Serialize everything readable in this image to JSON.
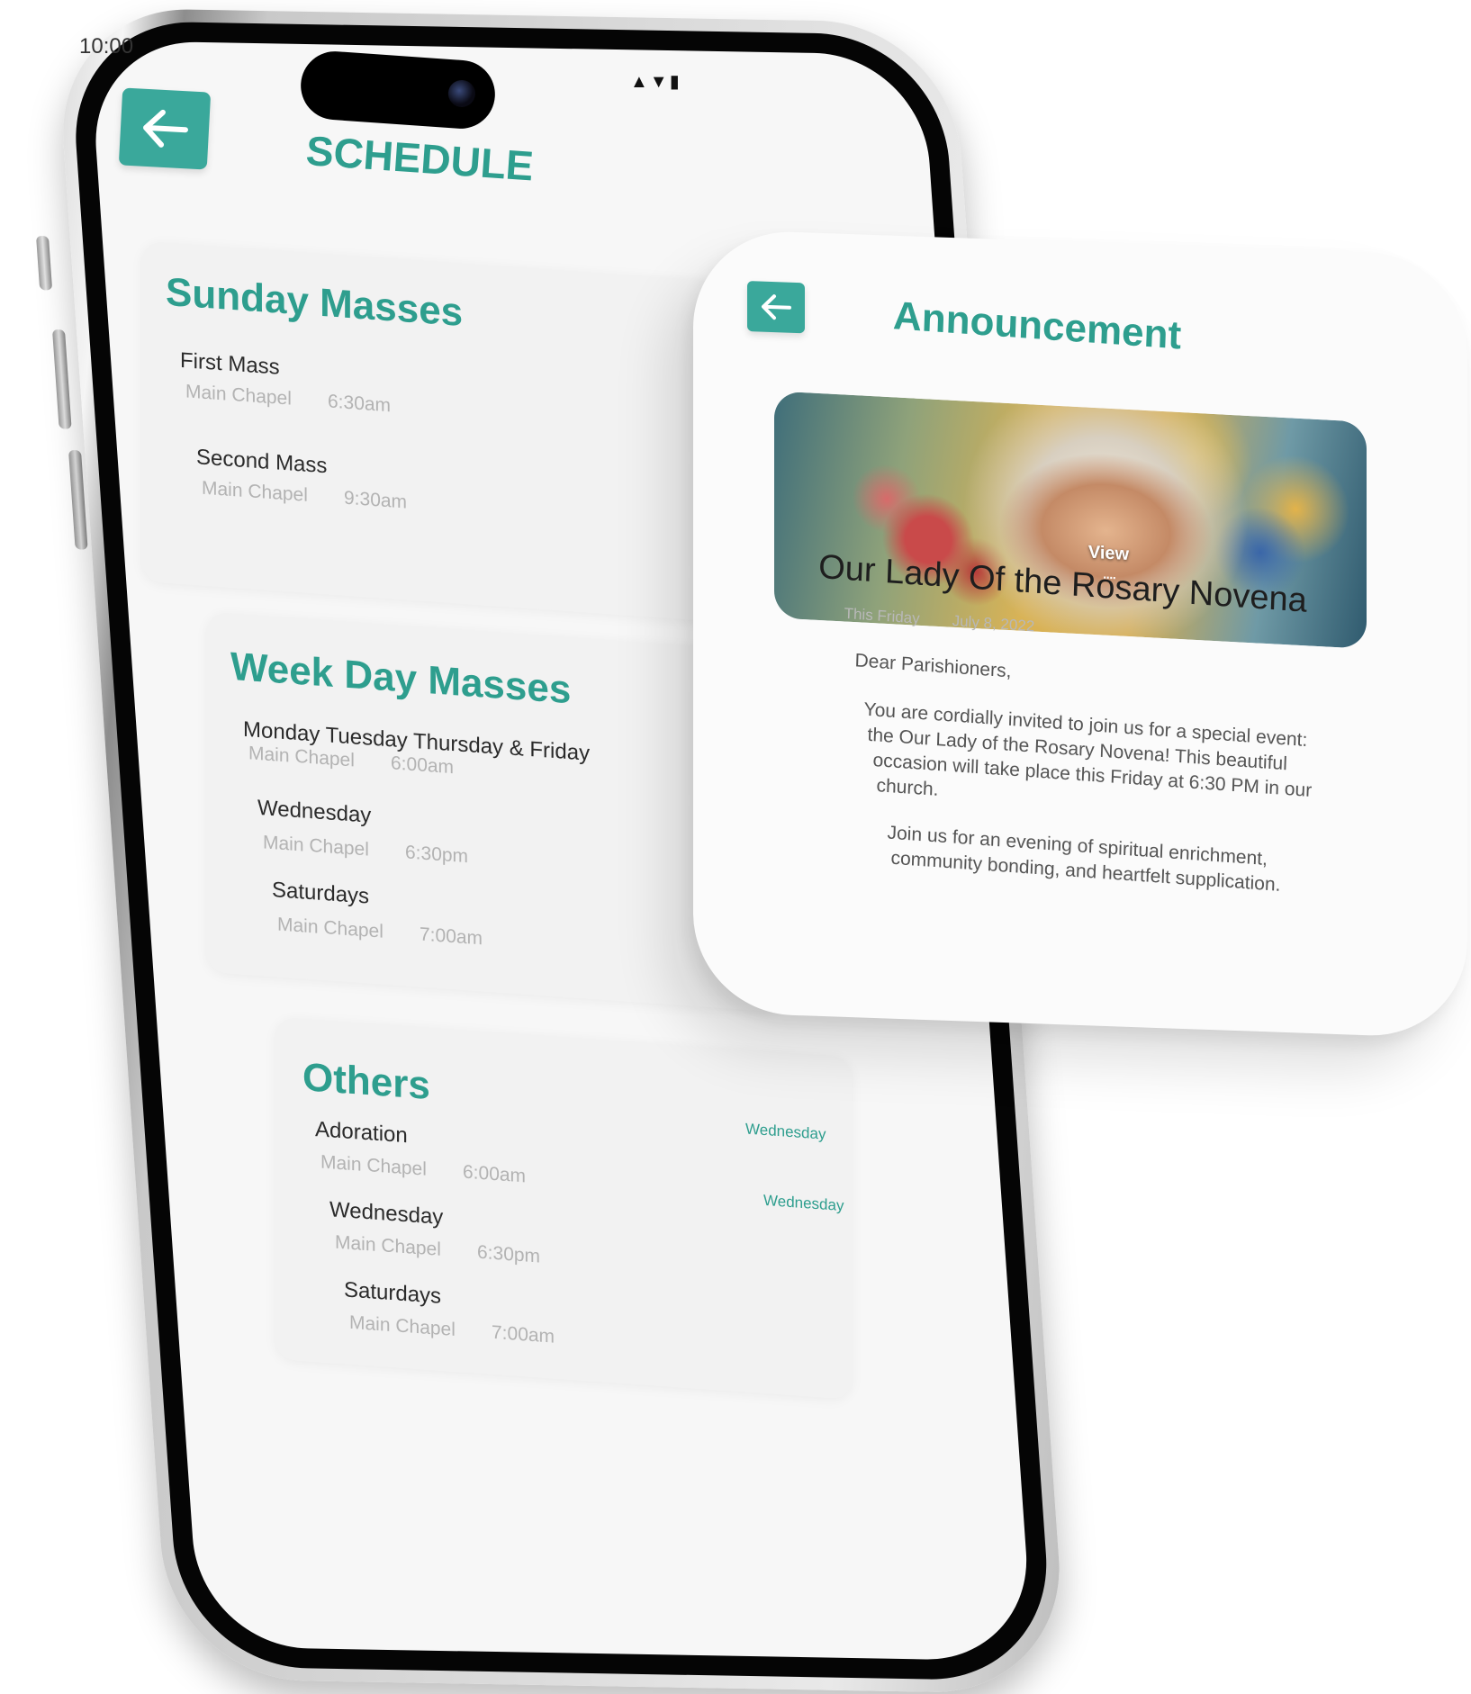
{
  "status_bar": {
    "time": "10:00"
  },
  "schedule": {
    "title": "SCHEDULE",
    "sections": [
      {
        "title": "Sunday Masses",
        "items": [
          {
            "name": "First Mass",
            "location": "Main Chapel",
            "time": "6:30am"
          },
          {
            "name": "Second Mass",
            "location": "Main Chapel",
            "time": "9:30am"
          }
        ]
      },
      {
        "title": "Week Day Masses",
        "items": [
          {
            "name": "Monday Tuesday Thursday & Friday",
            "location": "Main Chapel",
            "time": "6:00am"
          },
          {
            "name": "Wednesday",
            "location": "Main Chapel",
            "time": "6:30pm"
          },
          {
            "name": "Saturdays",
            "location": "Main Chapel",
            "time": "7:00am"
          }
        ]
      },
      {
        "title": "Others",
        "items": [
          {
            "name": "Adoration",
            "location": "Main Chapel",
            "time": "6:00am",
            "day": "Wednesday"
          },
          {
            "name": "Wednesday",
            "location": "Main Chapel",
            "time": "6:30pm",
            "day": "Wednesday"
          },
          {
            "name": "Saturdays",
            "location": "Main Chapel",
            "time": "7:00am"
          }
        ]
      }
    ]
  },
  "announcement": {
    "title": "Announcement",
    "image_action": "View",
    "image_dots": "....",
    "headline": "Our Lady Of the Rosary Novena",
    "when": "This Friday",
    "date": "July 8, 2022",
    "body_lines": [
      "Dear Parishioners,",
      "You are cordially invited to join us for a special event:",
      "the Our Lady of the Rosary Novena! This beautiful",
      "occasion will take place this Friday at 6:30 PM in our",
      "church.",
      "Join us for an evening of spiritual enrichment,",
      "community bonding, and heartfelt supplication."
    ]
  },
  "colors": {
    "accent": "#2e9e8e",
    "button": "#3aa89b",
    "muted_text": "#b3b3b3"
  },
  "icons": {
    "back": "arrow-left-icon",
    "signal": "signal-icon",
    "wifi": "wifi-icon",
    "battery": "battery-icon"
  }
}
